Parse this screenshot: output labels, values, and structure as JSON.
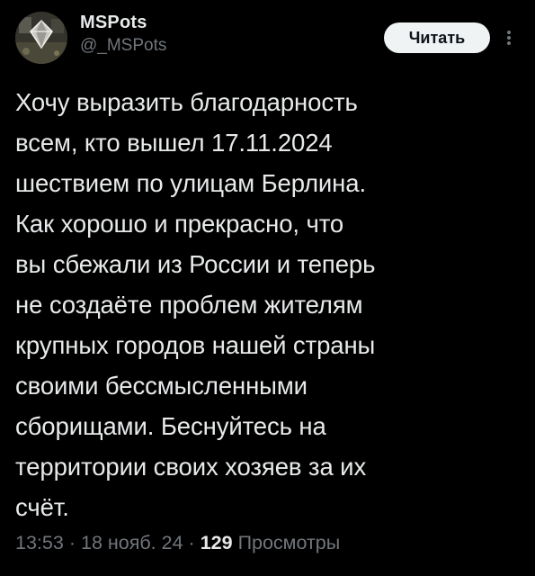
{
  "author": {
    "display_name": "MSPots",
    "handle": "@_MSPots"
  },
  "follow_button": {
    "label": "Читать"
  },
  "tweet": {
    "text": "Хочу выразить благодарность\nвсем, кто вышел 17.11.2024\nшествием по улицам Берлина.\nКак хорошо и прекрасно, что\nвы сбежали из России и теперь\nне создаёте проблем жителям\nкрупных городов нашей страны\nсвоими бессмысленными\nсборищами. Беснуйтесь на\nтерритории своих хозяев за их\nсчёт."
  },
  "meta": {
    "time": "13:53",
    "separator": "·",
    "date": "18 нояб. 24",
    "views_count": "129",
    "views_label": "Просмотры"
  },
  "colors": {
    "background": "#000000",
    "text": "#e7e9ea",
    "secondary_text": "#71767b",
    "button_bg": "#eff3f4",
    "button_text": "#0f1419"
  },
  "icons": {
    "more": "more-vertical-icon"
  }
}
